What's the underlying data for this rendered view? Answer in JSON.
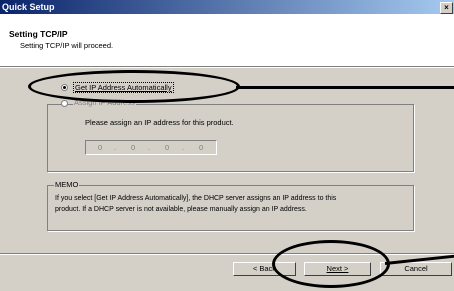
{
  "window": {
    "title": "Quick Setup",
    "close_symbol": "×"
  },
  "header": {
    "title": "Setting TCP/IP",
    "subtitle": "Setting TCP/IP will proceed."
  },
  "options": {
    "auto": {
      "label": "Get IP Address Automatically",
      "checked": true
    },
    "manual": {
      "label": "Assign IP Address",
      "checked": false
    }
  },
  "manual_group": {
    "instruction": "Please assign an IP address for this product.",
    "ip": [
      "0",
      "0",
      "0",
      "0"
    ]
  },
  "memo": {
    "title": "MEMO",
    "line1": "If you select [Get IP Address Automatically], the DHCP server assigns an IP address to this",
    "line2": "product. If a DHCP server is not available, please manually assign an IP address."
  },
  "buttons": {
    "back": "< Back",
    "next": "Next >",
    "cancel": "Cancel"
  }
}
